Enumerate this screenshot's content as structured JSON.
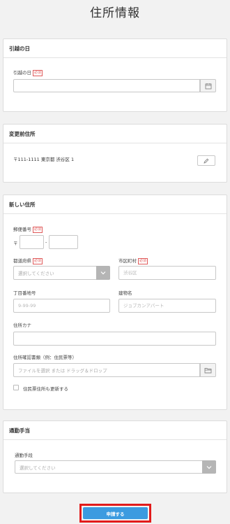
{
  "page_title": "住所情報",
  "required_badge": "必須",
  "moving_day": {
    "header": "引越の日",
    "label": "引越の日",
    "value": ""
  },
  "previous_address": {
    "header": "変更前住所",
    "address": "〒111-1111 東京都 渋谷区 1"
  },
  "new_address": {
    "header": "新しい住所",
    "postal_label": "郵便番号",
    "postal_prefix": "〒",
    "postal_separator": "-",
    "postal_first": "",
    "postal_second": "",
    "prefecture_label": "都道府県",
    "prefecture_placeholder": "選択してください",
    "city_label": "市区町村",
    "city_placeholder": "渋谷区",
    "street_label": "丁目番地号",
    "street_placeholder": "9-99-99",
    "building_label": "建物名",
    "building_placeholder": "ジョブカンアパート",
    "kana_label": "住所カナ",
    "kana_value": "",
    "document_label": "住所確認書類（例：住民票等）",
    "document_placeholder": "ファイルを選択 または ドラッグ＆ドロップ",
    "update_resident_label": "住民票住所も更新する"
  },
  "commute": {
    "header": "通勤手当",
    "method_label": "通勤手段",
    "method_placeholder": "選択してください"
  },
  "submit_label": "申請する"
}
